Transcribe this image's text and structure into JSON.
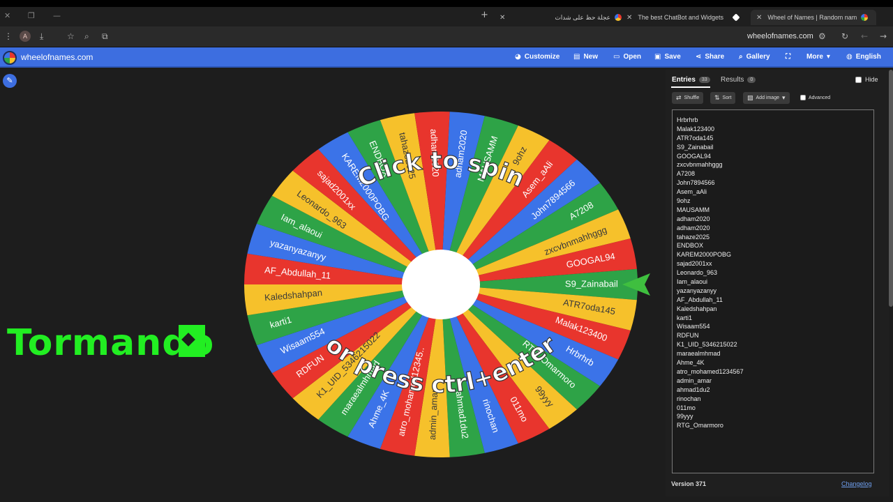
{
  "browser": {
    "tabs": [
      {
        "title": "عجلة حظ على شدات",
        "icon_color": "#3b73e8"
      },
      {
        "title": "The best ChatBot and Widgets",
        "icon_color": "#ffffff"
      },
      {
        "title": "Wheel of Names | Random nam",
        "icon_color": "#e8352d"
      }
    ],
    "url": "wheelofnames.com",
    "profile_letter": "A"
  },
  "header": {
    "site_name": "wheelofnames.com",
    "nav": [
      {
        "label": "Customize",
        "icon": "palette-icon"
      },
      {
        "label": "New",
        "icon": "new-file-icon"
      },
      {
        "label": "Open",
        "icon": "folder-icon"
      },
      {
        "label": "Save",
        "icon": "save-icon"
      },
      {
        "label": "Share",
        "icon": "share-icon"
      },
      {
        "label": "Gallery",
        "icon": "search-icon"
      },
      {
        "label": "More",
        "icon": "chevron-down-icon"
      },
      {
        "label": "English",
        "icon": "globe-icon"
      }
    ]
  },
  "overlay": {
    "streamer_text": "Tormando"
  },
  "wheel": {
    "top_text": "Click to spin",
    "bottom_text": "or press ctrl+enter",
    "colors": [
      "#2ea347",
      "#f6c12b",
      "#e8352d",
      "#3b73e8"
    ],
    "pointer_color": "#3fbf3f",
    "segments": [
      "S9_Zainabail",
      "ATR7oda145",
      "Malak123400",
      "Hrbrhrb",
      "RTG_Omarmoro",
      "99yyy",
      "011mo",
      "rinochan",
      "ahmad1du2",
      "admin_amar",
      "atro_mohamed12345..",
      "Ahme_4K",
      "maraealmhmad",
      "K1_UID_5346215022",
      "RDFUN",
      "Wisaam554",
      "karti1",
      "Kaledshahpan",
      "AF_Abdullah_11",
      "yazanyazanyy",
      "Iam_alaoui",
      "Leonardo_963",
      "sajad2001xx",
      "KAREM2000POBG",
      "ENDBOX",
      "tahaze2025",
      "adham2020",
      "adham2020",
      "MAUSAMM",
      "9ohz",
      "Asem_aAli",
      "John7894566",
      "A7208",
      "zxcvbnmahhggg",
      "GOOGAL94"
    ]
  },
  "panel": {
    "entries_tab": "Entries",
    "entries_count": "33",
    "results_tab": "Results",
    "results_count": "0",
    "hide_label": "Hide",
    "shuffle_label": "Shuffle",
    "sort_label": "Sort",
    "add_image_label": "Add image",
    "advanced_label": "Advanced",
    "entries": [
      "Hrbrhrb",
      "Malak123400",
      "ATR7oda145",
      "S9_Zainabail",
      "GOOGAL94",
      "zxcvbnmahhggg",
      "A7208",
      "John7894566",
      "Asem_aAli",
      "9ohz",
      "MAUSAMM",
      "adham2020",
      "adham2020",
      "tahaze2025",
      "ENDBOX",
      "KAREM2000POBG",
      "sajad2001xx",
      "Leonardo_963",
      "Iam_alaoui",
      "yazanyazanyy",
      "AF_Abdullah_11",
      "Kaledshahpan",
      "karti1",
      "Wisaam554",
      "RDFUN",
      "K1_UID_5346215022",
      "maraealmhmad",
      "Ahme_4K",
      "atro_mohamed1234567",
      "admin_amar",
      "ahmad1du2",
      "rinochan",
      "011mo",
      "99yyy",
      "RTG_Omarmoro"
    ],
    "version": "Version 371",
    "changelog": "Changelog"
  }
}
